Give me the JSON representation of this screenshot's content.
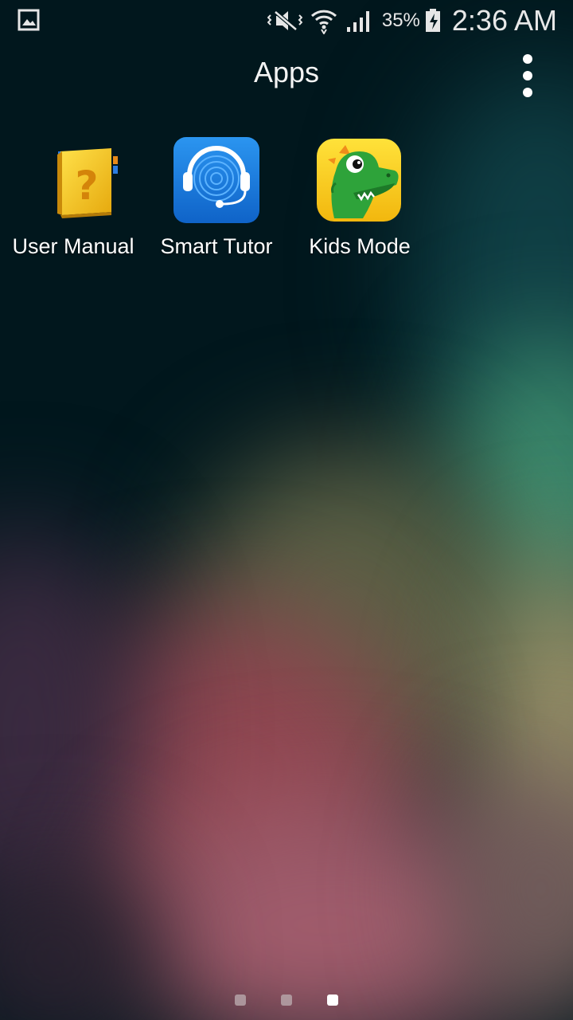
{
  "status_bar": {
    "left_icon": "gallery-icon",
    "icons": [
      "vibrate-mute-icon",
      "wifi-icon",
      "signal-icon"
    ],
    "battery_percent": "35%",
    "battery_icon": "battery-charging-icon",
    "time": "2:36 AM"
  },
  "header": {
    "title": "Apps",
    "menu_icon": "overflow-menu-icon"
  },
  "apps": [
    {
      "label": "User Manual",
      "icon": "user-manual-icon"
    },
    {
      "label": "Smart Tutor",
      "icon": "smart-tutor-icon"
    },
    {
      "label": "Kids Mode",
      "icon": "kids-mode-icon"
    }
  ],
  "page_indicator": {
    "count": 3,
    "active_index": 2
  },
  "colors": {
    "background": "#01171d",
    "smart_tutor_blue": "#1a7fe0",
    "user_manual_yellow": "#f2c21b",
    "kids_mode_yellow": "#f6d21c",
    "kids_mode_green": "#2ea33a"
  }
}
